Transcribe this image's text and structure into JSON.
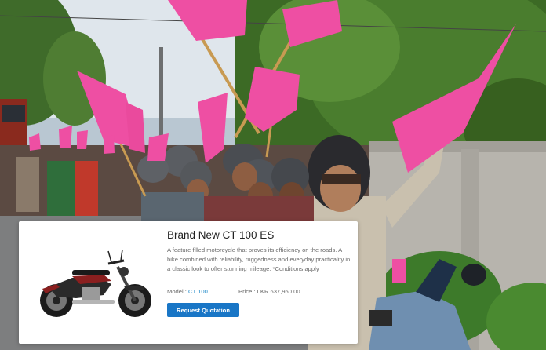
{
  "product": {
    "title": "Brand New CT 100 ES",
    "description": "A feature filled motorcycle that proves its efficiency on the roads. A bike combined with reliability, ruggedness and everyday practicality in a classic look to offer stunning mileage. *Conditions apply",
    "model_label": "Model :",
    "model_value": "CT 100",
    "price_label": "Price :",
    "price_value": "LKR 637,950.00",
    "cta_label": "Request Quotation"
  },
  "colors": {
    "flag_pink": "#ee4fa3",
    "link_blue": "#1e88c8",
    "button_blue": "#1976c6"
  }
}
